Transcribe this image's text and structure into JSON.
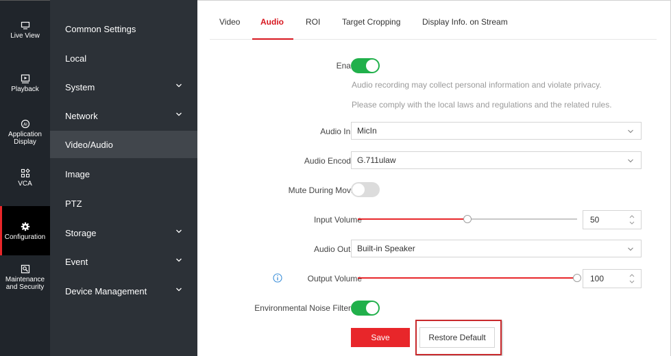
{
  "rail": {
    "items": [
      {
        "label": "Live View",
        "icon": "monitor-icon"
      },
      {
        "label": "Playback",
        "icon": "play-icon"
      },
      {
        "label": "Application Display",
        "icon": "ai-icon"
      },
      {
        "label": "VCA",
        "icon": "grid-icon"
      },
      {
        "label": "Configuration",
        "icon": "gear-icon",
        "active": true
      },
      {
        "label": "Maintenance and Security",
        "icon": "wrench-icon"
      }
    ]
  },
  "menu": {
    "items": [
      {
        "label": "Common Settings",
        "expandable": false
      },
      {
        "label": "Local",
        "expandable": false
      },
      {
        "label": "System",
        "expandable": true
      },
      {
        "label": "Network",
        "expandable": true
      },
      {
        "label": "Video/Audio",
        "expandable": false,
        "active": true
      },
      {
        "label": "Image",
        "expandable": false
      },
      {
        "label": "PTZ",
        "expandable": false
      },
      {
        "label": "Storage",
        "expandable": true
      },
      {
        "label": "Event",
        "expandable": true
      },
      {
        "label": "Device Management",
        "expandable": true
      }
    ]
  },
  "tabs": [
    {
      "label": "Video"
    },
    {
      "label": "Audio",
      "active": true
    },
    {
      "label": "ROI"
    },
    {
      "label": "Target Cropping"
    },
    {
      "label": "Display Info. on Stream"
    }
  ],
  "form": {
    "enable": {
      "label": "Enable",
      "on": true
    },
    "privacy_note_1": "Audio recording may collect personal information and violate privacy.",
    "privacy_note_2": "Please comply with the local laws and regulations and the related rules.",
    "audio_input": {
      "label": "Audio Input",
      "value": "MicIn"
    },
    "audio_encoding": {
      "label": "Audio Encoding",
      "value": "G.711ulaw"
    },
    "mute_during_moving": {
      "label": "Mute During Moving",
      "on": false
    },
    "input_volume": {
      "label": "Input Volume",
      "value": "50",
      "level": 0.5
    },
    "audio_output": {
      "label": "Audio Output",
      "value": "Built-in Speaker"
    },
    "output_volume": {
      "label": "Output Volume",
      "value": "100",
      "level": 1.0
    },
    "noise_filter": {
      "label": "Environmental Noise Filtering",
      "on": true
    }
  },
  "buttons": {
    "save": "Save",
    "restore": "Restore Default"
  },
  "colors": {
    "accent": "#e8262a",
    "toggle_on": "#21b04b"
  }
}
